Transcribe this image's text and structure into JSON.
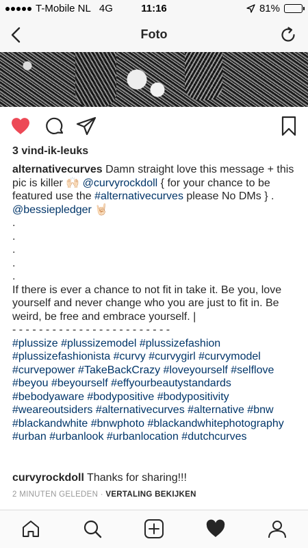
{
  "status_bar": {
    "carrier": "T-Mobile NL",
    "network": "4G",
    "time": "11:16",
    "battery_text": "81%",
    "battery_level": 0.81
  },
  "nav": {
    "title": "Foto"
  },
  "post": {
    "likes": "3 vind-ik-leuks",
    "liked": true,
    "caption": {
      "username": "alternativecurves",
      "intro": " Damn straight love this message + this pic is killer 🙌🏻 ",
      "mention1": "@curvyrockdoll",
      "mid1": " { for your chance to be featured use the ",
      "hashtag_feature": "#alternativecurves",
      "mid2": " please No DMs } . ",
      "mention2": "@bessiepledger",
      "emoji_end": " 🤘🏻",
      "dots": [
        ".",
        ".",
        ".",
        ".",
        "."
      ],
      "message": "If there is ever a chance to not fit in take it. Be you, love yourself and never change who you are just to fit in. Be weird, be free and embrace yourself. |",
      "dashes": "- - - - - - - - - - - - - - - - - - - - - - - -",
      "hashtags": "#plussize #plussizemodel #plussizefashion #plussizefashionista #curvy #curvygirl #curvymodel #curvepower #TakeBackCrazy #loveyourself #selflove #beyou #beyourself #effyourbeautystandards #bebodyaware #bodypositive #bodypositivity #weareoutsiders #alternativecurves #alternative #bnw #blackandwhite #bnwphoto #blackandwhitephotography #urban #urbanlook #urbanlocation #dutchcurves"
    },
    "comment": {
      "username": "curvyrockdoll",
      "text": " Thanks for sharing!!!"
    },
    "timestamp": "2 MINUTEN GELEDEN",
    "separator": " · ",
    "translate_label": "VERTALING BEKIJKEN"
  },
  "colors": {
    "like_red": "#ed4956",
    "link_blue": "#003569",
    "text": "#262626",
    "muted": "#999999"
  },
  "tabs": [
    "home-icon",
    "search-icon",
    "add-post-icon",
    "activity-heart-icon",
    "profile-icon"
  ]
}
